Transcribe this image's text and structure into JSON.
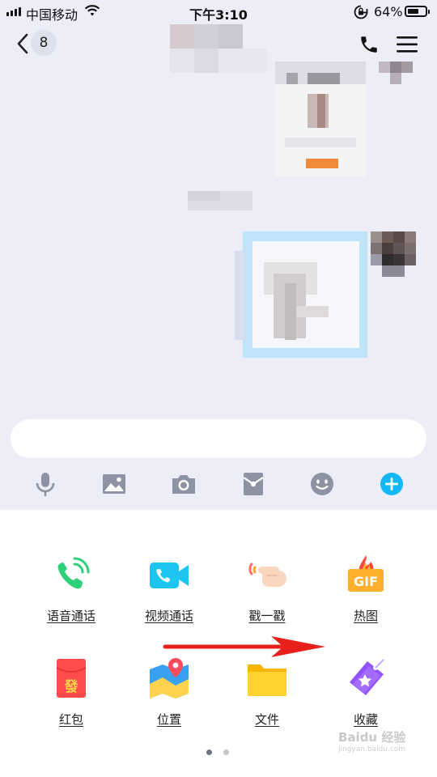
{
  "status_bar": {
    "carrier": "中国移动",
    "time": "下午3:10",
    "battery_pct": "64%",
    "battery_level": 0.64
  },
  "header": {
    "unread_count": "8"
  },
  "input": {
    "value": "",
    "placeholder": ""
  },
  "toolbar": {
    "icons": [
      "microphone-icon",
      "image-icon",
      "camera-icon",
      "red-envelope-icon",
      "emoji-icon",
      "plus-icon"
    ],
    "accent_color": "#12b7f5"
  },
  "panel": {
    "apps": [
      {
        "label": "语音通话",
        "icon": "voice-call-icon"
      },
      {
        "label": "视频通话",
        "icon": "video-call-icon"
      },
      {
        "label": "戳一戳",
        "icon": "poke-icon"
      },
      {
        "label": "热图",
        "icon": "gif-icon"
      },
      {
        "label": "红包",
        "icon": "red-packet-icon"
      },
      {
        "label": "位置",
        "icon": "location-icon"
      },
      {
        "label": "文件",
        "icon": "folder-icon"
      },
      {
        "label": "收藏",
        "icon": "favorites-icon"
      }
    ],
    "page_count": 2,
    "current_page": 1
  },
  "watermark": {
    "brand": "Baidu 经验",
    "url": "jingyan.baidu.com"
  }
}
